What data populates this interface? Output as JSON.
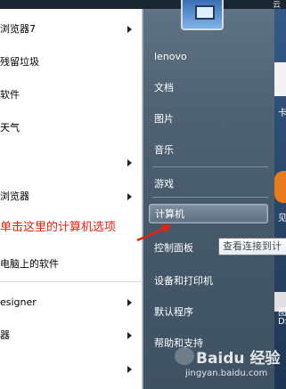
{
  "top_strip": {
    "left_text": "",
    "mid_text": "",
    "right_text": "云"
  },
  "programs": [
    {
      "label": "浏览器7",
      "submenu": true
    },
    {
      "label": "残留垃圾",
      "submenu": false
    },
    {
      "label": "软件",
      "submenu": false
    },
    {
      "label": "天气",
      "submenu": false
    },
    {
      "label": "",
      "submenu": true
    },
    {
      "label": "浏览器",
      "submenu": true
    },
    {
      "label": "电脑上的软件",
      "submenu": false
    },
    {
      "label": "esigner",
      "submenu": true
    },
    {
      "label": "器",
      "submenu": true
    },
    {
      "label": "",
      "submenu": true
    }
  ],
  "places": [
    {
      "label": "lenovo",
      "submenu": false
    },
    {
      "label": "文档",
      "submenu": false
    },
    {
      "label": "图片",
      "submenu": false
    },
    {
      "label": "音乐",
      "submenu": false
    },
    {
      "label": "游戏",
      "submenu": false
    },
    {
      "label": "计算机",
      "submenu": false,
      "selected": true
    },
    {
      "label": "控制面板",
      "submenu": false
    },
    {
      "label": "设备和打印机",
      "submenu": false
    },
    {
      "label": "默认程序",
      "submenu": false
    },
    {
      "label": "帮助和支持",
      "submenu": false
    }
  ],
  "tooltip": {
    "text": "查看连接到计"
  },
  "annotation": {
    "text": "单击这里的计算机选项",
    "color": "#e8200f"
  },
  "desktop_text": [
    "卡",
    "见",
    "图",
    "DS"
  ],
  "watermark": {
    "brand": "Baidu 经验",
    "url": "jingyan.baidu.com"
  },
  "colors": {
    "right_pane": "#4f6375",
    "left_pane": "#ffffff",
    "annotation_red": "#e8200f"
  }
}
